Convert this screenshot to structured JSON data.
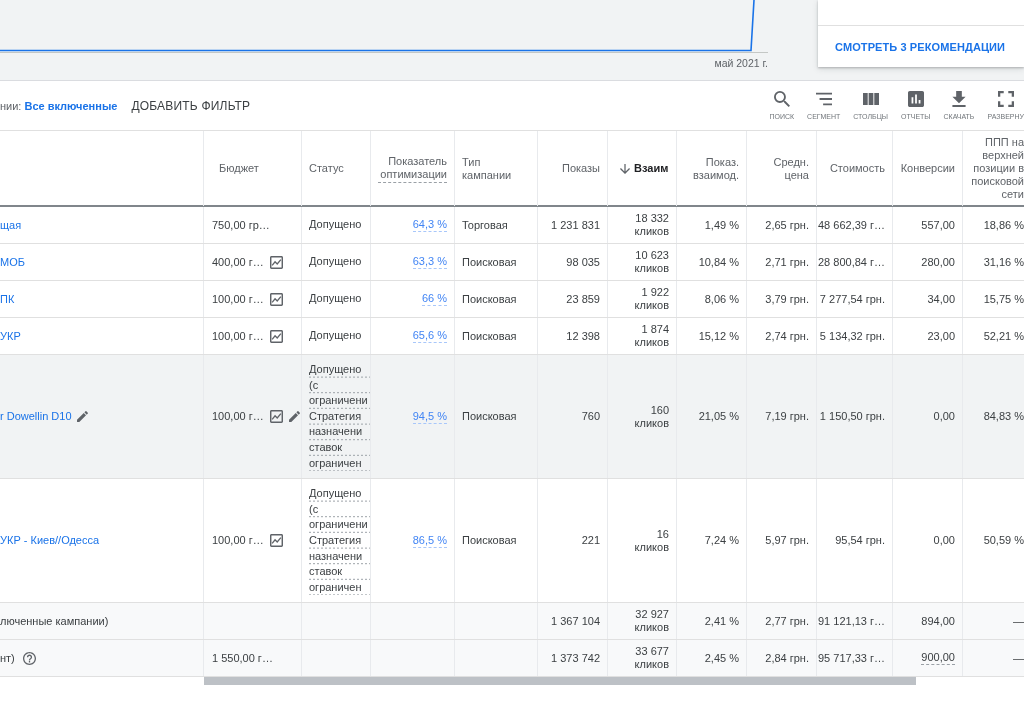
{
  "overview": {
    "chart": {
      "x_label": "май 2021 г."
    },
    "recommendations": {
      "link": "СМОТРЕТЬ 3 РЕКОМЕНДАЦИИ"
    }
  },
  "filter_bar": {
    "filter": "нии: **Все включенные**",
    "add_filter": "ДОБАВИТЬ ФИЛЬТР",
    "tools": [
      {
        "kind": "search",
        "label": "ПОИСК"
      },
      {
        "kind": "segment",
        "label": "СЕГМЕНТ"
      },
      {
        "kind": "columns",
        "label": "СТОЛБЦЫ"
      },
      {
        "kind": "reports",
        "label": "ОТЧЕТЫ"
      },
      {
        "kind": "download",
        "label": "СКАЧАТЬ"
      },
      {
        "kind": "expand",
        "label": "РАЗВЕРНУ"
      }
    ]
  },
  "table": {
    "columns": [
      {
        "label": "Бюджет",
        "sorted": false,
        "tooltip": false
      },
      {
        "label": "Статус",
        "sorted": false,
        "tooltip": false
      },
      {
        "label": "Показатель оптимизации",
        "sorted": false,
        "tooltip": true
      },
      {
        "label": "Тип кампании",
        "sorted": false,
        "tooltip": false
      },
      {
        "label": "Показы",
        "sorted": false,
        "tooltip": false
      },
      {
        "label": "Взаим",
        "sorted": true,
        "tooltip": false
      },
      {
        "label": "Показ. взаимод.",
        "sorted": false,
        "tooltip": false
      },
      {
        "label": "Средн. цена",
        "sorted": false,
        "tooltip": false
      },
      {
        "label": "Стоимость",
        "sorted": false,
        "tooltip": false
      },
      {
        "label": "Конверсии",
        "sorted": false,
        "tooltip": false
      },
      {
        "label": "ППП на верхней позиции в поисковой сети",
        "sorted": false,
        "tooltip": false
      }
    ],
    "rows": [
      {
        "name": "щая",
        "hovered": false,
        "budget": "750,00 гр…",
        "trend_icon": false,
        "status": "Допущено",
        "optimization_score": "64,3 %",
        "campaign_type": "Торговая",
        "impressions": "1 231 831",
        "interactions": "18 332 кликов",
        "interaction_rate": "1,49 %",
        "avg_cost": "2,65 грн.",
        "cost": "48 662,39 г…",
        "conversions": "557,00",
        "top_impression_rate": "18,86 %"
      },
      {
        "name": "МОБ",
        "hovered": false,
        "budget": "400,00 г…",
        "trend_icon": true,
        "status": "Допущено",
        "optimization_score": "63,3 %",
        "campaign_type": "Поисковая",
        "impressions": "98 035",
        "interactions": "10 623 кликов",
        "interaction_rate": "10,84 %",
        "avg_cost": "2,71 грн.",
        "cost": "28 800,84 г…",
        "conversions": "280,00",
        "top_impression_rate": "31,16 %"
      },
      {
        "name": "ПК",
        "hovered": false,
        "budget": "100,00 г…",
        "trend_icon": true,
        "status": "Допущено",
        "optimization_score": "66 %",
        "campaign_type": "Поисковая",
        "impressions": "23 859",
        "interactions": "1 922 кликов",
        "interaction_rate": "8,06 %",
        "avg_cost": "3,79 грн.",
        "cost": "7 277,54 грн.",
        "conversions": "34,00",
        "top_impression_rate": "15,75 %"
      },
      {
        "name": "УКР",
        "hovered": false,
        "budget": "100,00 г…",
        "trend_icon": true,
        "status": "Допущено",
        "optimization_score": "65,6 %",
        "campaign_type": "Поисковая",
        "impressions": "12 398",
        "interactions": "1 874 кликов",
        "interaction_rate": "15,12 %",
        "avg_cost": "2,74 грн.",
        "cost": "5 134,32 грн.",
        "conversions": "23,00",
        "top_impression_rate": "52,21 %"
      },
      {
        "name": "r Dowellin D10",
        "hovered": true,
        "budget": "100,00 г…",
        "trend_icon": true,
        "status": "Допущено (с ограничени",
        "status_detail": "Стратегия назначени ставок ограничен",
        "optimization_score": "94,5 %",
        "campaign_type": "Поисковая",
        "impressions": "760",
        "interactions": "160 кликов",
        "interaction_rate": "21,05 %",
        "avg_cost": "7,19 грн.",
        "cost": "1 150,50 грн.",
        "conversions": "0,00",
        "top_impression_rate": "84,83 %"
      },
      {
        "name": "УКР - Киев//Одесса",
        "hovered": false,
        "budget": "100,00 г…",
        "trend_icon": true,
        "status": "Допущено (с ограничени",
        "status_detail": "Стратегия назначени ставок ограничен",
        "optimization_score": "86,5 %",
        "campaign_type": "Поисковая",
        "impressions": "221",
        "interactions": "16 кликов",
        "interaction_rate": "7,24 %",
        "avg_cost": "5,97 грн.",
        "cost": "95,54 грн.",
        "conversions": "0,00",
        "top_impression_rate": "50,59 %"
      }
    ],
    "totals": [
      {
        "label": "люченные кампании)",
        "help_icon": false,
        "impressions": "1 367 104",
        "interactions": "32 927 кликов",
        "interaction_rate": "2,41 %",
        "avg_cost": "2,77 грн.",
        "cost": "91 121,13 г…",
        "conversions": "894,00",
        "conversions_tooltip": false,
        "top_impression_rate": "—"
      },
      {
        "label": "нт)",
        "help_icon": true,
        "budget": "1 550,00 г…",
        "impressions": "1 373 742",
        "interactions": "33 677 кликов",
        "interaction_rate": "2,45 %",
        "avg_cost": "2,84 грн.",
        "cost": "95 717,33 г…",
        "conversions": "900,00",
        "conversions_tooltip": true,
        "top_impression_rate": "—"
      }
    ]
  }
}
